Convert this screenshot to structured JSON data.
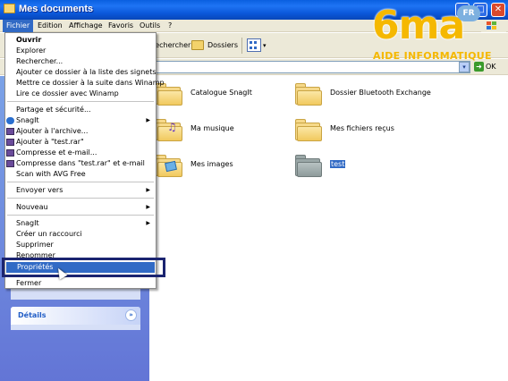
{
  "window": {
    "title": "Mes documents"
  },
  "menubar": {
    "items": [
      "Fichier",
      "Edition",
      "Affichage",
      "Favoris",
      "Outils",
      "?"
    ]
  },
  "toolbar": {
    "search_label": "Rechercher",
    "folders_label": "Dossiers"
  },
  "addressbar": {
    "go_label": "OK"
  },
  "file_menu": {
    "open": "Ouvrir",
    "explore": "Explorer",
    "search": "Rechercher...",
    "add_to_winamp_bookmarks": "Ajouter ce dossier à la liste des signets",
    "enqueue_winamp": "Mettre ce dossier à la suite dans Winamp",
    "play_winamp": "Lire ce dossier avec Winamp",
    "sharing": "Partage et sécurité...",
    "snagit": "SnagIt",
    "add_archive": "Ajouter à l'archive...",
    "add_test_rar": "Ajouter à \"test.rar\"",
    "compress_email": "Compresse et e-mail...",
    "compress_test_email": "Compresse dans \"test.rar\" et e-mail",
    "scan_avg": "Scan with AVG Free",
    "send_to": "Envoyer vers",
    "new": "Nouveau",
    "snagit2": "SnagIt",
    "create_shortcut": "Créer un raccourci",
    "delete": "Supprimer",
    "rename": "Renommer",
    "properties": "Propriétés",
    "close": "Fermer"
  },
  "left_pane": {
    "details_label": "Détails"
  },
  "folders": [
    {
      "name": "Catalogue SnagIt"
    },
    {
      "name": "Dossier Bluetooth Exchange"
    },
    {
      "name": "Ma musique"
    },
    {
      "name": "Mes fichiers reçus"
    },
    {
      "name": "Mes images"
    },
    {
      "name": "test"
    }
  ],
  "watermark": {
    "logo": "6ma",
    "badge": "FR",
    "tagline": "AIDE INFORMATIQUE"
  },
  "colors": {
    "title_bar": "#0a5fe0",
    "selection": "#316ac5",
    "highlight_box": "#1b2470",
    "watermark": "#f5b800"
  }
}
